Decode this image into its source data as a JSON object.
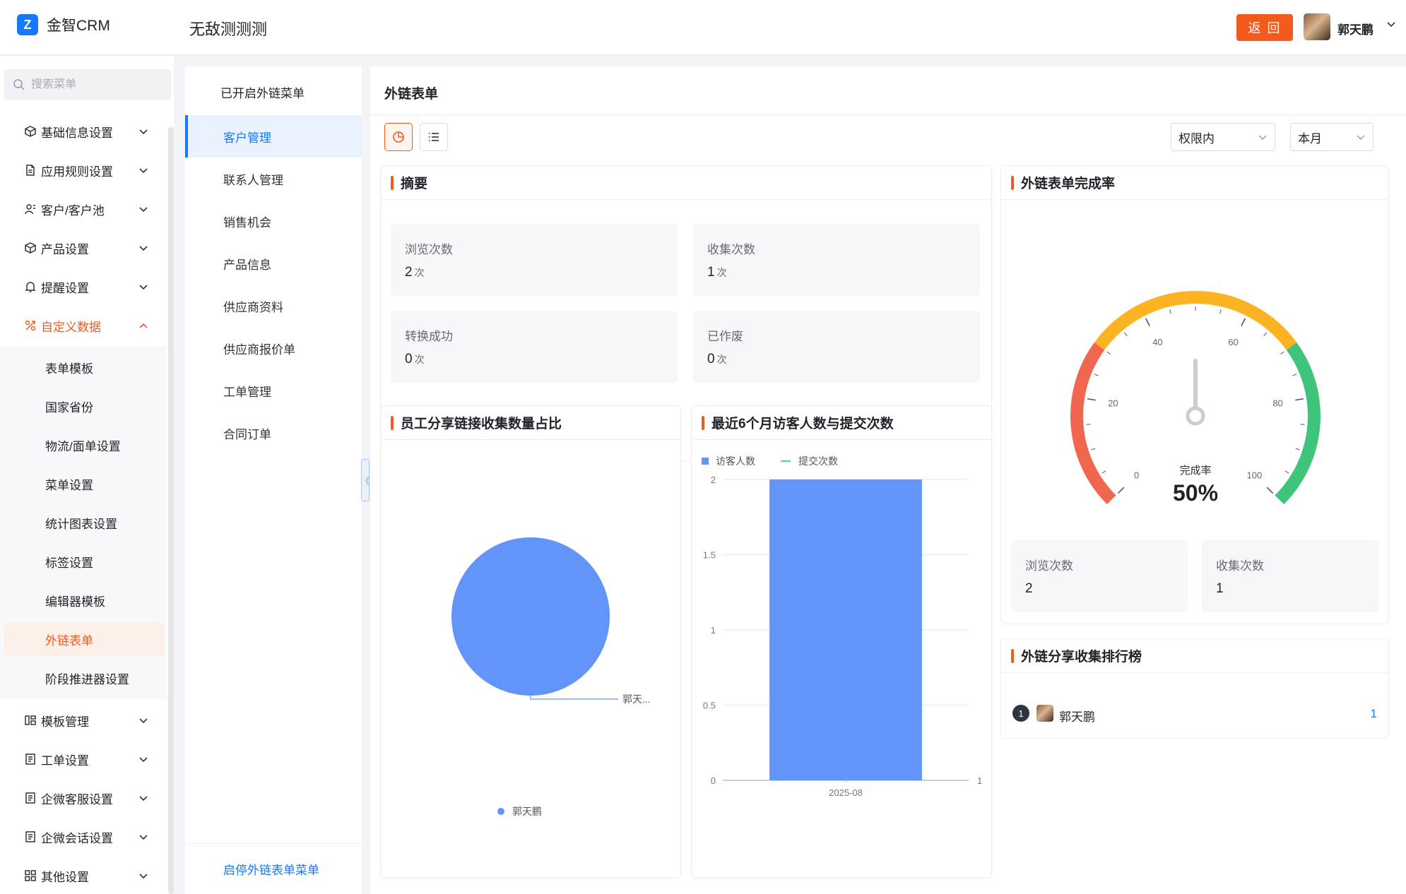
{
  "header": {
    "logo_text": "金智CRM",
    "app_title": "无敌测测测",
    "back_label": "返 回",
    "user_name": "郭天鹏"
  },
  "sidebar": {
    "search_placeholder": "搜索菜单",
    "items": [
      {
        "label": "基础信息设置",
        "icon": "cube-icon"
      },
      {
        "label": "应用规则设置",
        "icon": "document-icon"
      },
      {
        "label": "客户/客户池",
        "icon": "contacts-icon"
      },
      {
        "label": "产品设置",
        "icon": "cube-icon"
      },
      {
        "label": "提醒设置",
        "icon": "bell-icon"
      },
      {
        "label": "自定义数据",
        "icon": "custom-data-icon",
        "expanded": true
      }
    ],
    "subitems": [
      "表单模板",
      "国家省份",
      "物流/面单设置",
      "菜单设置",
      "统计图表设置",
      "标签设置",
      "编辑器模板",
      "外链表单",
      "阶段推进器设置"
    ],
    "active_subitem": "外链表单",
    "items_after": [
      {
        "label": "模板管理",
        "icon": "template-icon"
      },
      {
        "label": "工单设置",
        "icon": "form-icon"
      },
      {
        "label": "企微客服设置",
        "icon": "form-icon"
      },
      {
        "label": "企微会话设置",
        "icon": "form-icon"
      },
      {
        "label": "其他设置",
        "icon": "grid-icon"
      }
    ]
  },
  "column2": {
    "title": "已开启外链菜单",
    "items": [
      "客户管理",
      "联系人管理",
      "销售机会",
      "产品信息",
      "供应商资料",
      "供应商报价单",
      "工单管理",
      "合同订单"
    ],
    "active": "客户管理",
    "footer": "启停外链表单菜单",
    "collapse_glyph": "《"
  },
  "main": {
    "title": "外链表单",
    "filter_scope": "权限内",
    "filter_period": "本月",
    "summary": {
      "title": "摘要",
      "unit": "次",
      "stats": [
        {
          "label": "浏览次数",
          "value": "2"
        },
        {
          "label": "收集次数",
          "value": "1"
        },
        {
          "label": "转换成功",
          "value": "0"
        },
        {
          "label": "已作废",
          "value": "0"
        }
      ]
    },
    "completion": {
      "title": "外链表单完成率",
      "label": "完成率",
      "value": "50%",
      "ticks": [
        "0",
        "20",
        "40",
        "60",
        "80",
        "100"
      ],
      "stats": [
        {
          "label": "浏览次数",
          "value": "2"
        },
        {
          "label": "收集次数",
          "value": "1"
        }
      ],
      "colors": {
        "low": "#f0664e",
        "mid": "#fbb321",
        "high": "#3ec47b"
      }
    },
    "pie_card": {
      "title": "员工分享链接收集数量占比",
      "slice_label": "郭天...",
      "legend": "郭天鹏",
      "color": "#6294f9"
    },
    "bar_card": {
      "title": "最近6个月访客人数与提交次数",
      "legend": [
        "访客人数",
        "提交次数"
      ],
      "colors": [
        "#6294f9",
        "#5ad8a6"
      ]
    },
    "ranking": {
      "title": "外链分享收集排行榜",
      "rows": [
        {
          "rank": "1",
          "name": "郭天鹏",
          "value": "1"
        }
      ]
    }
  },
  "chart_data": [
    {
      "type": "pie",
      "title": "员工分享链接收集数量占比",
      "categories": [
        "郭天鹏"
      ],
      "values": [
        1
      ]
    },
    {
      "type": "bar",
      "title": "最近6个月访客人数与提交次数",
      "categories": [
        "2025-08"
      ],
      "series": [
        {
          "name": "访客人数",
          "type": "bar",
          "values": [
            2
          ],
          "axis": "left"
        },
        {
          "name": "提交次数",
          "type": "line",
          "values": [
            0
          ],
          "axis": "right"
        }
      ],
      "ylim": [
        0,
        2
      ],
      "yticks": [
        "0",
        "0.5",
        "1",
        "1.5",
        "2"
      ],
      "y2ticks": [
        "1"
      ]
    },
    {
      "type": "gauge",
      "title": "外链表单完成率",
      "value": 50,
      "range": [
        0,
        100
      ],
      "ticks": [
        "0",
        "20",
        "40",
        "60",
        "80",
        "100"
      ]
    }
  ]
}
